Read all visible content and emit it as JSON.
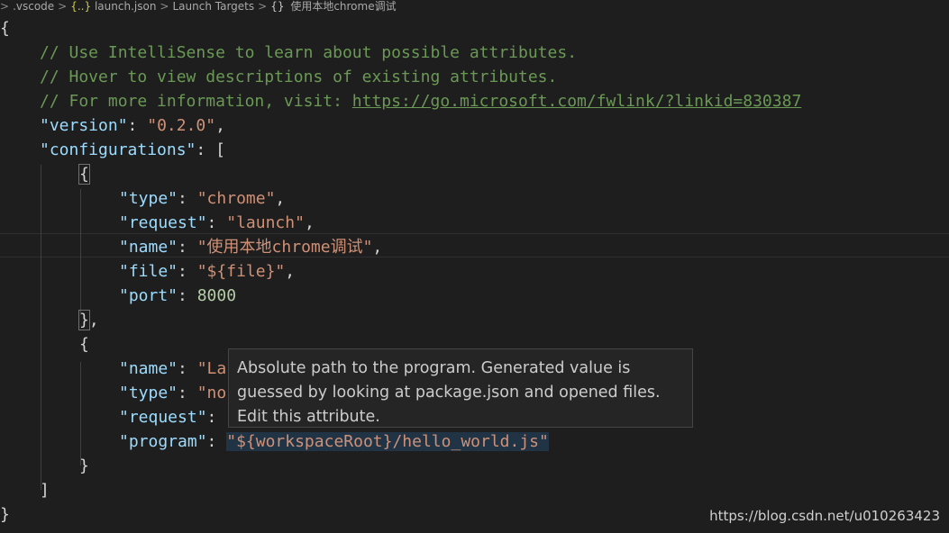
{
  "breadcrumb": {
    "items": [
      ".vscode",
      "launch.json",
      "Launch Targets",
      "使用本地chrome调试"
    ],
    "json_icon": "{..}",
    "object_icon": "{}",
    "separator": ">"
  },
  "code": {
    "comment1": "// Use IntelliSense to learn about possible attributes.",
    "comment2": "// Hover to view descriptions of existing attributes.",
    "comment3_prefix": "// For more information, visit: ",
    "comment3_link": "https://go.microsoft.com/fwlink/?linkid=830387",
    "version_key": "\"version\"",
    "version_value": "\"0.2.0\"",
    "configurations_key": "\"configurations\"",
    "config1": {
      "type_key": "\"type\"",
      "type_value": "\"chrome\"",
      "request_key": "\"request\"",
      "request_value": "\"launch\"",
      "name_key": "\"name\"",
      "name_value": "\"使用本地chrome调试\"",
      "file_key": "\"file\"",
      "file_value": "\"${file}\"",
      "port_key": "\"port\"",
      "port_value": "8000"
    },
    "config2": {
      "name_key": "\"name\"",
      "name_value_partial": "\"La",
      "type_key": "\"type\"",
      "type_value_partial": "\"no",
      "request_key": "\"request\"",
      "program_key": "\"program\"",
      "program_value": "\"${workspaceRoot}/hello_world.js\""
    }
  },
  "tooltip": {
    "line1": "Absolute path to the program. Generated value is",
    "line2": "guessed by looking at package.json and opened files.",
    "line3": "Edit this attribute."
  },
  "watermark": "https://blog.csdn.net/u010263423"
}
